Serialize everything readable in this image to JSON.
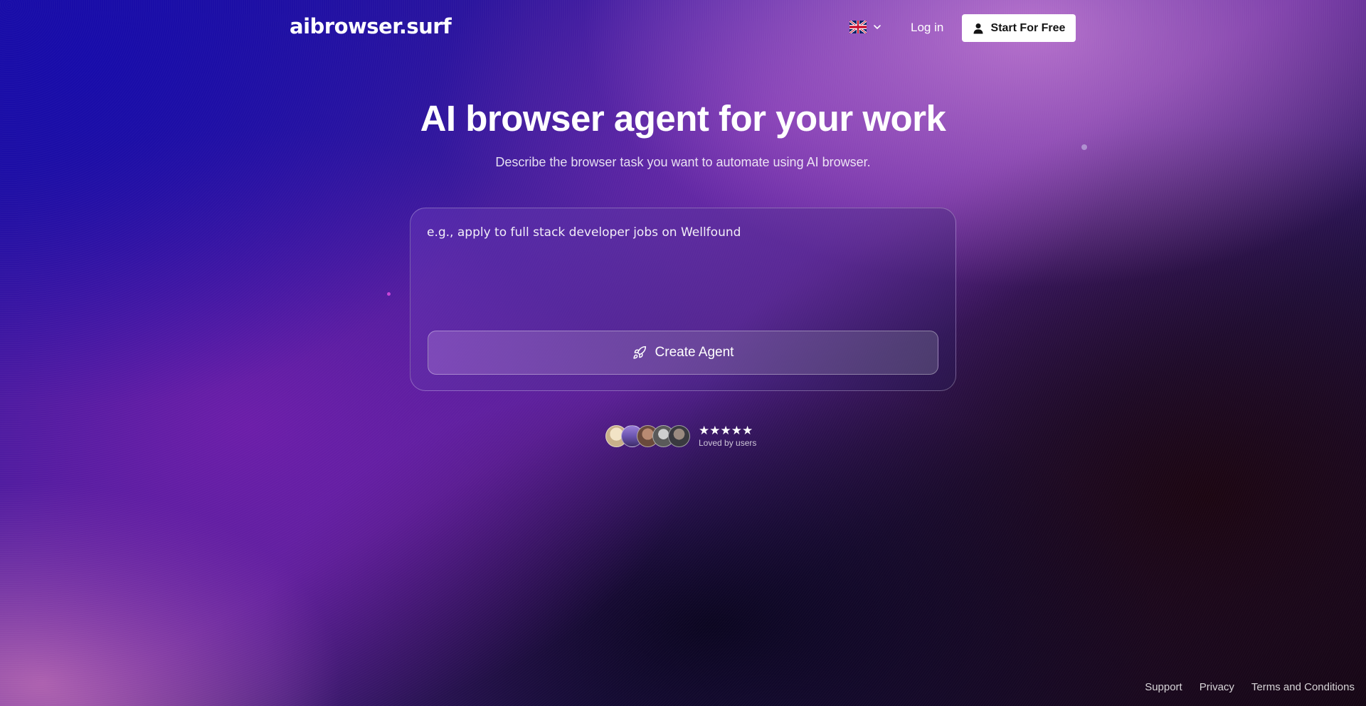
{
  "header": {
    "logo_text": "aibrowser.surf",
    "language_icon": "uk-flag-icon",
    "login_label": "Log in",
    "start_label": "Start For Free"
  },
  "hero": {
    "title": "AI browser agent for your work",
    "subtitle": "Describe the browser task you want to automate using AI browser."
  },
  "task": {
    "placeholder": "e.g., apply to full stack developer jobs on Wellfound",
    "value": "",
    "create_label": "Create Agent",
    "create_icon": "rocket-icon"
  },
  "social_proof": {
    "stars": "★★★★★",
    "rating_count": 5,
    "caption": "Loved by users",
    "avatar_count": 5
  },
  "footer": {
    "links": [
      "Support",
      "Privacy",
      "Terms and Conditions"
    ]
  },
  "colors": {
    "start_button_bg": "#ffffff",
    "start_button_text": "#141414",
    "text": "#ffffff"
  }
}
